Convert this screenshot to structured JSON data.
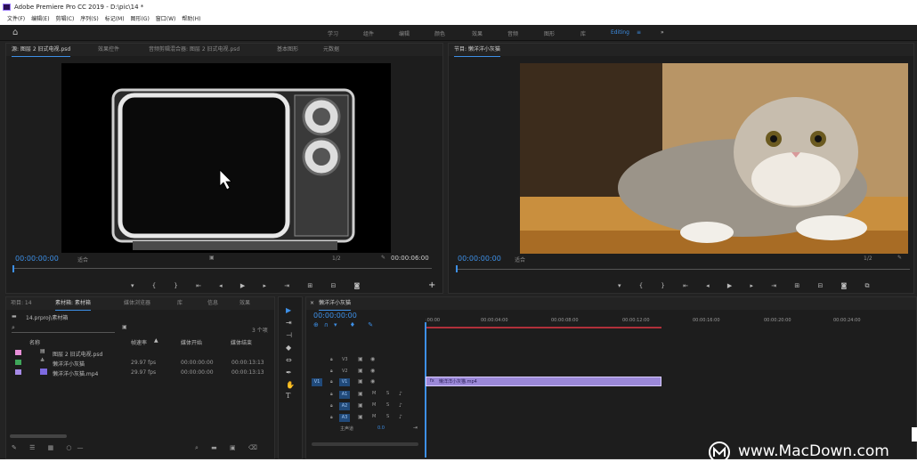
{
  "app": {
    "title": "Adobe Premiere Pro CC 2019 - D:\\pic\\14 *"
  },
  "menu": [
    "文件(F)",
    "编辑(E)",
    "剪辑(C)",
    "序列(S)",
    "标记(M)",
    "图形(G)",
    "窗口(W)",
    "帮助(H)"
  ],
  "workspaces": [
    "学习",
    "组件",
    "编辑",
    "颜色",
    "效果",
    "音频",
    "图形",
    "库",
    "Editing"
  ],
  "source_panel": {
    "tabs": [
      "源: 图层 2 旧式电视.psd",
      "效果控件",
      "音频剪辑混合器: 图层 2 旧式电视.psd",
      "基本图形",
      "元数据"
    ],
    "timecode_in": "00:00:00:00",
    "fit": "适合",
    "quality": "1/2",
    "timecode_out": "00:00:06:00"
  },
  "program_panel": {
    "tab": "节目: 懒洋洋小灰猫",
    "timecode": "00:00:00:00",
    "fit": "适合",
    "quality": "1/2"
  },
  "project_panel": {
    "tabs": [
      "项目: 14",
      "素材箱: 素材箱",
      "媒体浏览器",
      "库",
      "信息",
      "效果"
    ],
    "bin_path": "14.prproj\\素材箱",
    "count": "3 个项",
    "headers": [
      "名称",
      "帧速率",
      "媒体开始",
      "媒体结束"
    ],
    "items": [
      {
        "name": "图层 2 旧式电视.psd",
        "fps": "",
        "start": "",
        "end": "",
        "color": "#e88fd8"
      },
      {
        "name": "懒洋洋小灰猫",
        "fps": "29.97 fps",
        "start": "00:00:00:00",
        "end": "00:00:13:13",
        "color": "#3fa65a"
      },
      {
        "name": "懒洋洋小灰猫.mp4",
        "fps": "29.97 fps",
        "start": "00:00:00:00",
        "end": "00:00:13:13",
        "color": "#a68ae6"
      }
    ]
  },
  "timeline": {
    "tab": "懒洋洋小灰猫",
    "timecode": "00:00:00:00",
    "ruler": [
      ":00:00",
      "00:00:04:00",
      "00:00:08:00",
      "00:00:12:00",
      "00:00:16:00",
      "00:00:20:00",
      "00:00:24:00"
    ],
    "video_tracks": [
      "V3",
      "V2",
      "V1"
    ],
    "audio_tracks": [
      "A1",
      "A2",
      "A3"
    ],
    "master": "主声道",
    "master_val": "0.0",
    "clip_label": "懒洋洋小灰猫.mp4",
    "src_patch": "V1"
  },
  "watermark": "www.MacDown.com"
}
